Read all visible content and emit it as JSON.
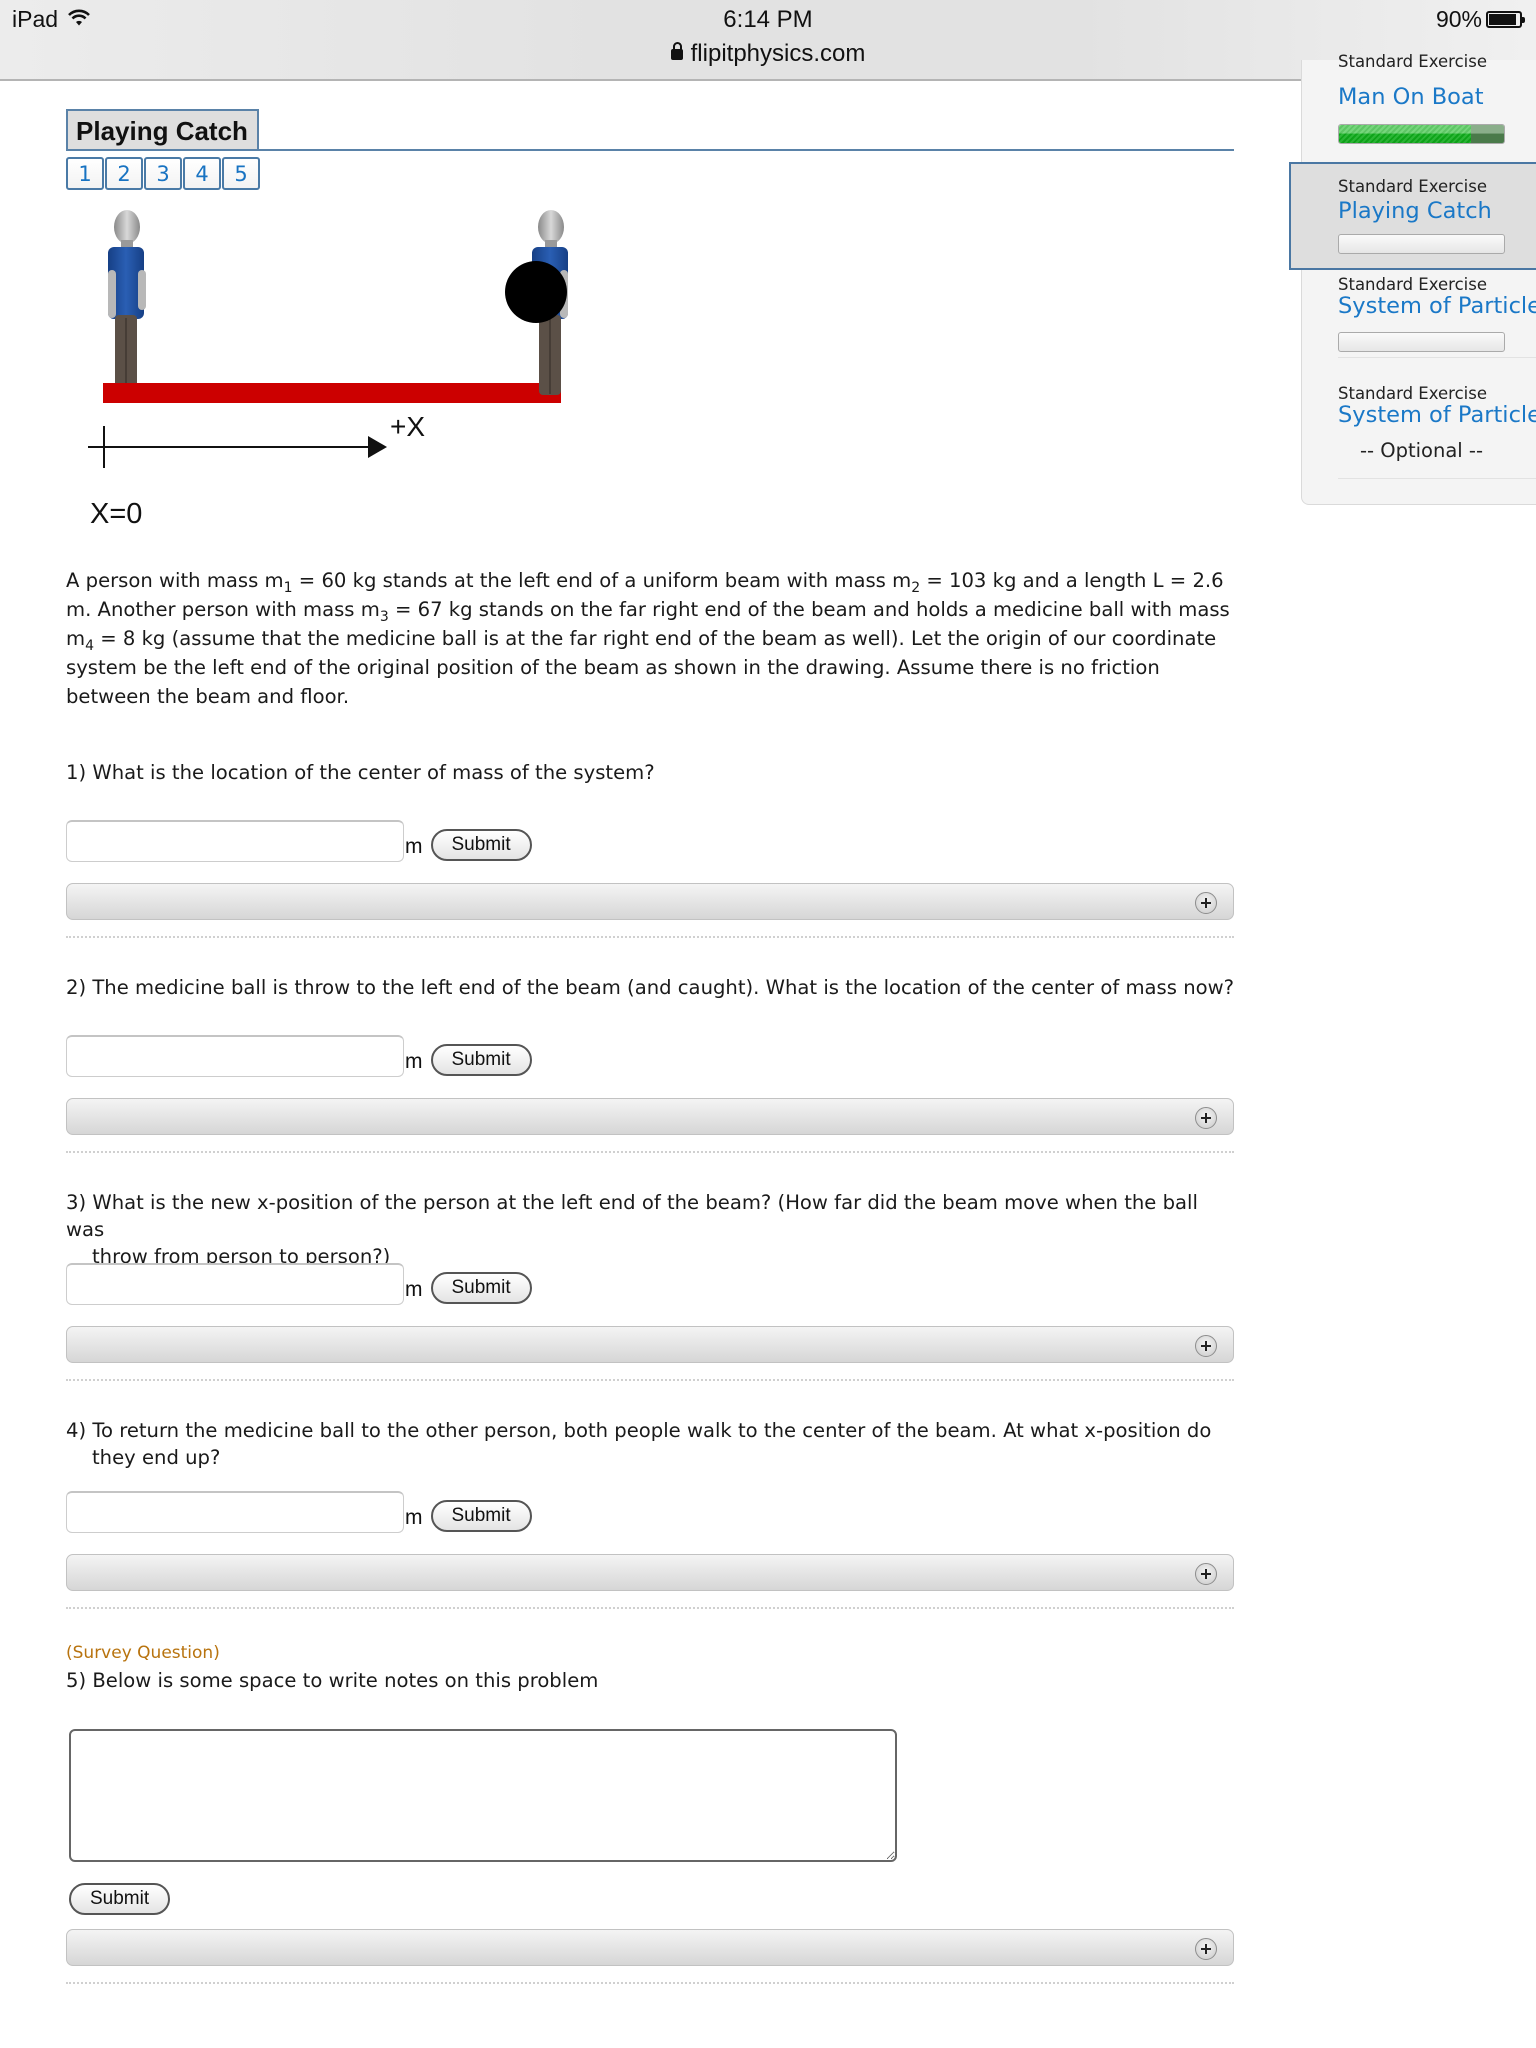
{
  "status_bar": {
    "device": "iPad",
    "wifi_icon": "wifi-icon",
    "time": "6:14 PM",
    "url": "flipitphysics.com",
    "lock_icon": "lock-icon",
    "battery": "90%",
    "battery_level": 0.9
  },
  "exercise": {
    "title": "Playing Catch",
    "pages": [
      "1",
      "2",
      "3",
      "4",
      "5"
    ]
  },
  "diagram": {
    "axis_label": "+X",
    "origin_label": "X=0",
    "colors": {
      "beam": "#cc0000",
      "shirt": "#1f4fa0",
      "pants": "#5b5047",
      "head": "#a8a8a8",
      "ball": "#000000"
    }
  },
  "problem": {
    "parts": [
      "A person with mass m",
      "1",
      " = 60 kg stands at the left end of a uniform beam with mass m",
      "2",
      " = 103 kg and a length L = 2.6 m. Another person with mass m",
      "3",
      " = 67 kg stands on the far right end of the beam and holds a medicine ball with mass m",
      "4",
      " = 8 kg (assume that the medicine ball is at the far right end of the beam as well). Let the origin of our coordinate system be the left end of the original position of the beam as shown in the drawing. Assume there is no friction between the beam and floor."
    ]
  },
  "questions": [
    {
      "line1": "1) What is the location of the center of mass of the system?",
      "line2": "",
      "unit": "m",
      "submit": "Submit",
      "value": ""
    },
    {
      "line1": "2) The medicine ball is throw to the left end of the beam (and caught). What is the location of the center of mass now?",
      "line2": "",
      "unit": "m",
      "submit": "Submit",
      "value": ""
    },
    {
      "line1": "3) What is the new x-position of the person at the left end of the beam? (How far did the beam move when the ball was",
      "line2": "throw from person to person?)",
      "unit": "m",
      "submit": "Submit",
      "value": ""
    },
    {
      "line1": "4) To return the medicine ball to the other person, both people walk to the center of the beam. At what x-position do",
      "line2": "they end up?",
      "unit": "m",
      "submit": "Submit",
      "value": ""
    }
  ],
  "survey": {
    "label": "(Survey Question)",
    "question": "5) Below is some space to write notes on this problem",
    "notes_value": "",
    "submit": "Submit",
    "label_color": "#b8730e"
  },
  "sidebar": {
    "items": [
      {
        "kind": "Standard Exercise",
        "title": "Man On Boat",
        "progress": 0.8,
        "active": false
      },
      {
        "kind": "Standard Exercise",
        "title": "Playing Catch",
        "progress": 0,
        "active": true
      },
      {
        "kind": "Standard Exercise",
        "title": "System of Particles",
        "progress": 0,
        "active": false
      },
      {
        "kind": "Standard Exercise",
        "title": "System of Particles",
        "note": "-- Optional --",
        "active": false
      }
    ],
    "accent": "#1a78c7"
  }
}
